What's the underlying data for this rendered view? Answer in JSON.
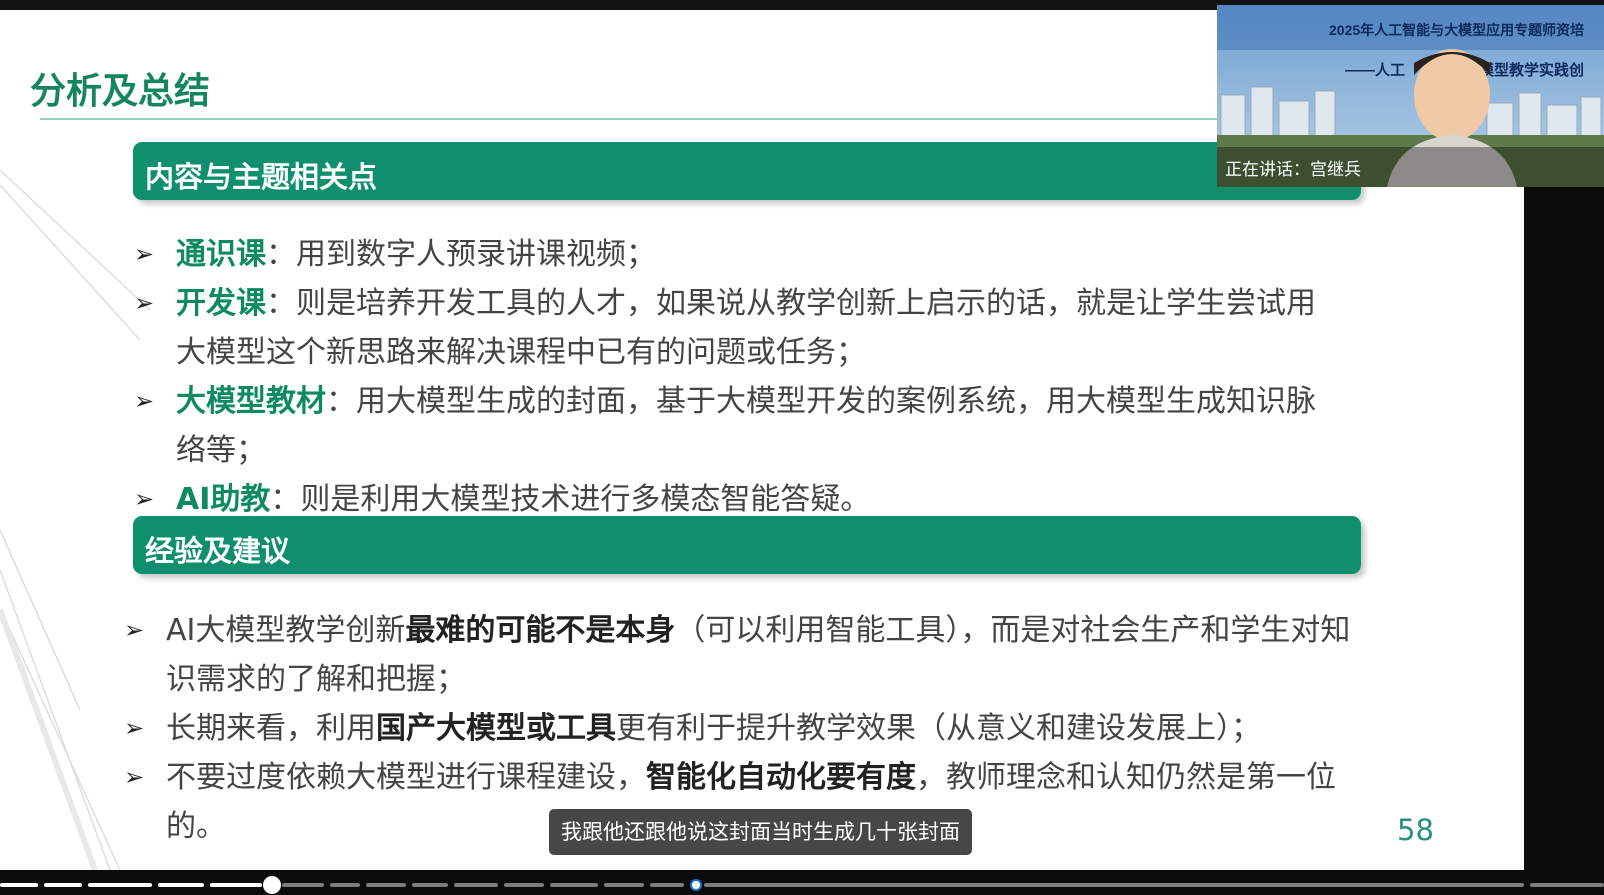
{
  "slide": {
    "title": "分析及总结",
    "page_number": "58",
    "section1": {
      "heading": "内容与主题相关点",
      "items": [
        {
          "key": "通识课",
          "text": "：用到数字人预录讲课视频；"
        },
        {
          "key": "开发课",
          "text": "：则是培养开发工具的人才，如果说从教学创新上启示的话，就是让学生尝试用大模型这个新思路来解决课程中已有的问题或任务；"
        },
        {
          "key": "大模型教材",
          "text": "：用大模型生成的封面，基于大模型开发的案例系统，用大模型生成知识脉络等；"
        },
        {
          "key": "AI助教",
          "text": "：则是利用大模型技术进行多模态智能答疑。"
        }
      ]
    },
    "section2": {
      "heading": "经验及建议",
      "items": [
        {
          "before": "AI大模型教学创新",
          "bold": "最难的可能不是本身",
          "after": "（可以利用智能工具），而是对社会生产和学生对知识需求的了解和把握；"
        },
        {
          "before": "长期来看，利用",
          "bold": "国产大模型或工具",
          "after": "更有利于提升教学效果（从意义和建设发展上）；"
        },
        {
          "before": "不要过度依赖大模型进行课程建设，",
          "bold": "智能化自动化要有度",
          "after": "，教师理念和认知仍然是第一位的。"
        }
      ]
    }
  },
  "subtitle": "我跟他还跟他说这封面当时生成几十张封面",
  "video": {
    "banner_line1": "2025年人工智能与大模型应用专题师资培",
    "banner_line2": "——人工",
    "banner_line2b": "模型教学实践创",
    "speaker_label": "正在讲话：宫继兵"
  },
  "icons": {
    "bullet": "arrow-bullet-icon"
  },
  "colors": {
    "accent_green": "#0f8f6e",
    "title_green": "#14855f",
    "page_number": "#2a8f82"
  }
}
